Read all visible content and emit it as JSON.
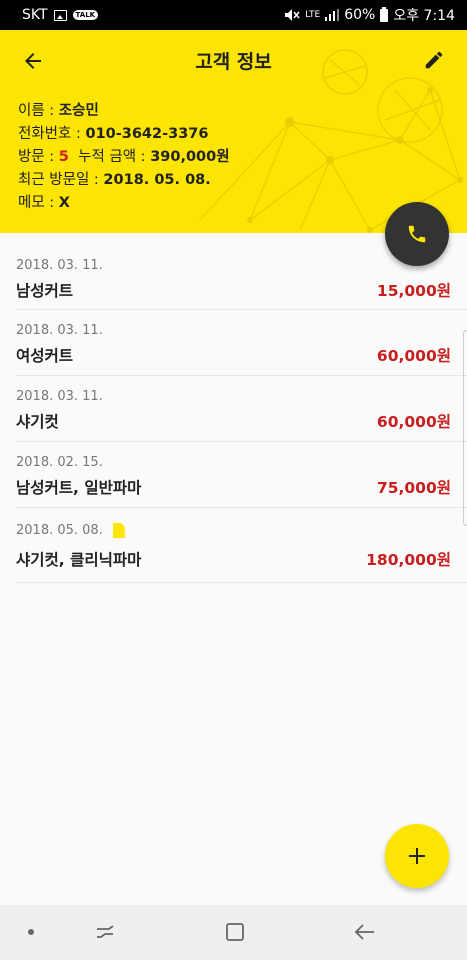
{
  "status_bar": {
    "carrier": "SKT",
    "talk_badge": "TALK",
    "network": "LTE",
    "battery": "60%",
    "time": "오후 7:14"
  },
  "header": {
    "title": "고객 정보",
    "accent_color": "#fce502"
  },
  "customer": {
    "name_label": "이름 : ",
    "name": "조승민",
    "phone_label": "전화번호 : ",
    "phone": "010-3642-3376",
    "visits_label": "방문 : ",
    "visits": "5",
    "total_label": "누적 금액 : ",
    "total": "390,000원",
    "last_visit_label": "최근 방문일 : ",
    "last_visit": "2018. 05. 08.",
    "memo_label": "메모 : ",
    "memo": "X"
  },
  "visits": [
    {
      "date": "2018. 03. 11.",
      "service": "남성커트",
      "price": "15,000원"
    },
    {
      "date": "2018. 03. 11.",
      "service": "여성커트",
      "price": "60,000원"
    },
    {
      "date": "2018. 03. 11.",
      "service": "샤기컷",
      "price": "60,000원"
    },
    {
      "date": "2018. 02. 15.",
      "service": "남성커트, 일반파마",
      "price": "75,000원"
    },
    {
      "date": "2018. 05. 08.",
      "service": "샤기컷, 클리닉파마",
      "price": "180,000원",
      "has_memo": true
    }
  ],
  "icons": {
    "back": "arrow-left-icon",
    "edit": "pencil-icon",
    "call": "phone-icon",
    "add": "plus-icon",
    "memo": "note-icon"
  }
}
